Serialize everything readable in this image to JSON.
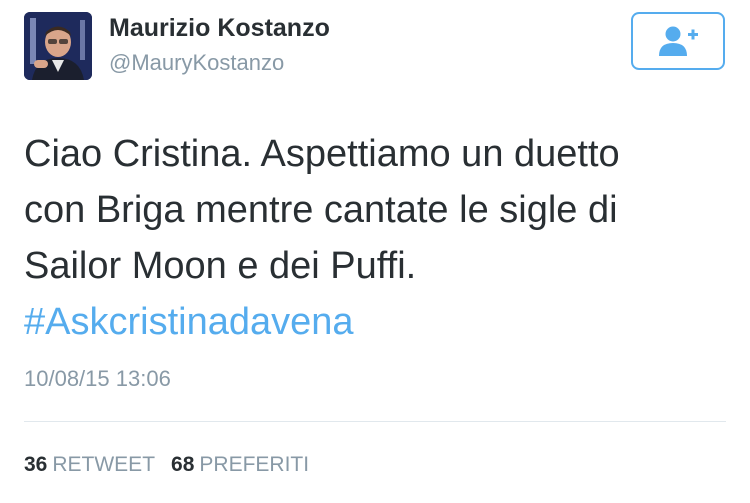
{
  "user": {
    "display_name": "Maurizio Kostanzo",
    "handle": "@MauryKostanzo"
  },
  "follow_button": {
    "icon": "add-user-icon",
    "color": "#55acee"
  },
  "tweet": {
    "lines": [
      "Ciao Cristina. Aspettiamo un duetto",
      "con Briga mentre cantate le sigle di",
      "Sailor Moon e dei Puffi."
    ],
    "hashtag": "#Askcristinadavena",
    "timestamp": "10/08/15 13:06"
  },
  "stats": {
    "retweets_count": "36",
    "retweets_label": "RETWEET",
    "favorites_count": "68",
    "favorites_label": "PREFERITI"
  },
  "colors": {
    "text": "#292f33",
    "muted": "#8899a6",
    "accent": "#55acee",
    "divider": "#e1e8ed"
  }
}
